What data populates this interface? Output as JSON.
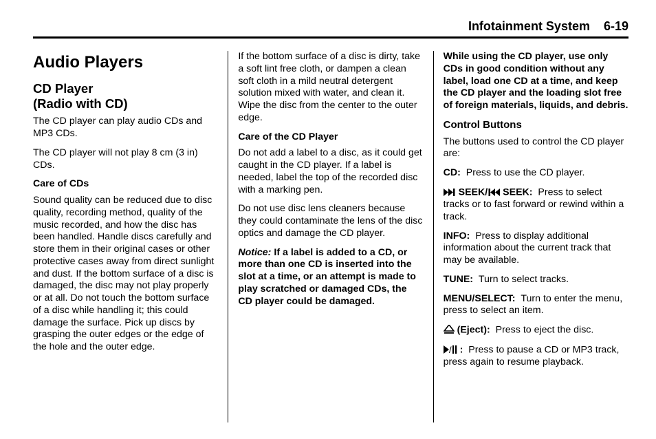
{
  "header": {
    "title": "Infotainment System",
    "page": "6-19"
  },
  "col1": {
    "h1": "Audio Players",
    "h2a": "CD Player",
    "h2b": "(Radio with CD)",
    "p1": "The CD player can play audio CDs and MP3 CDs.",
    "p2": "The CD player will not play 8 cm (3 in) CDs.",
    "h4a": "Care of CDs",
    "p3": "Sound quality can be reduced due to disc quality, recording method, quality of the music recorded, and how the disc has been handled. Handle discs carefully and store them in their original cases or other protective cases away from direct sunlight and dust. If the bottom surface of a disc is damaged, the disc may not play properly or at all. Do not touch the bottom surface of a disc while handling it; this could damage the surface. Pick up discs by grasping the outer edges or the edge of the hole and the outer edge."
  },
  "col2": {
    "p1": "If the bottom surface of a disc is dirty, take a soft lint free cloth, or dampen a clean soft cloth in a mild neutral detergent solution mixed with water, and clean it. Wipe the disc from the center to the outer edge.",
    "h4a": "Care of the CD Player",
    "p2": "Do not add a label to a disc, as it could get caught in the CD player. If a label is needed, label the top of the recorded disc with a marking pen.",
    "p3": "Do not use disc lens cleaners because they could contaminate the lens of the disc optics and damage the CD player.",
    "notice_label": "Notice:",
    "notice_text": "If a label is added to a CD, or more than one CD is inserted into the slot at a time, or an attempt is made to play scratched or damaged CDs, the CD player could be damaged."
  },
  "col3": {
    "warning": "While using the CD player, use only CDs in good condition without any label, load one CD at a time, and keep the CD player and the loading slot free of foreign materials, liquids, and debris.",
    "h3a": "Control Buttons",
    "p1": "The buttons used to control the CD player are:",
    "cd_label": "CD:",
    "cd_text": "Press to use the CD player.",
    "seek_label1": "SEEK/",
    "seek_label2": "SEEK:",
    "seek_text": "Press to select tracks or to fast forward or rewind within a track.",
    "info_label": "INFO:",
    "info_text": "Press to display additional information about the current track that may be available.",
    "tune_label": "TUNE:",
    "tune_text": "Turn to select tracks.",
    "menu_label": "MENU/SELECT:",
    "menu_text": "Turn to enter the menu, press to select an item.",
    "eject_label": "(Eject):",
    "eject_text": "Press to eject the disc.",
    "playpause_label": ":",
    "playpause_text": "Press to pause a CD or MP3 track, press again to resume playback."
  }
}
